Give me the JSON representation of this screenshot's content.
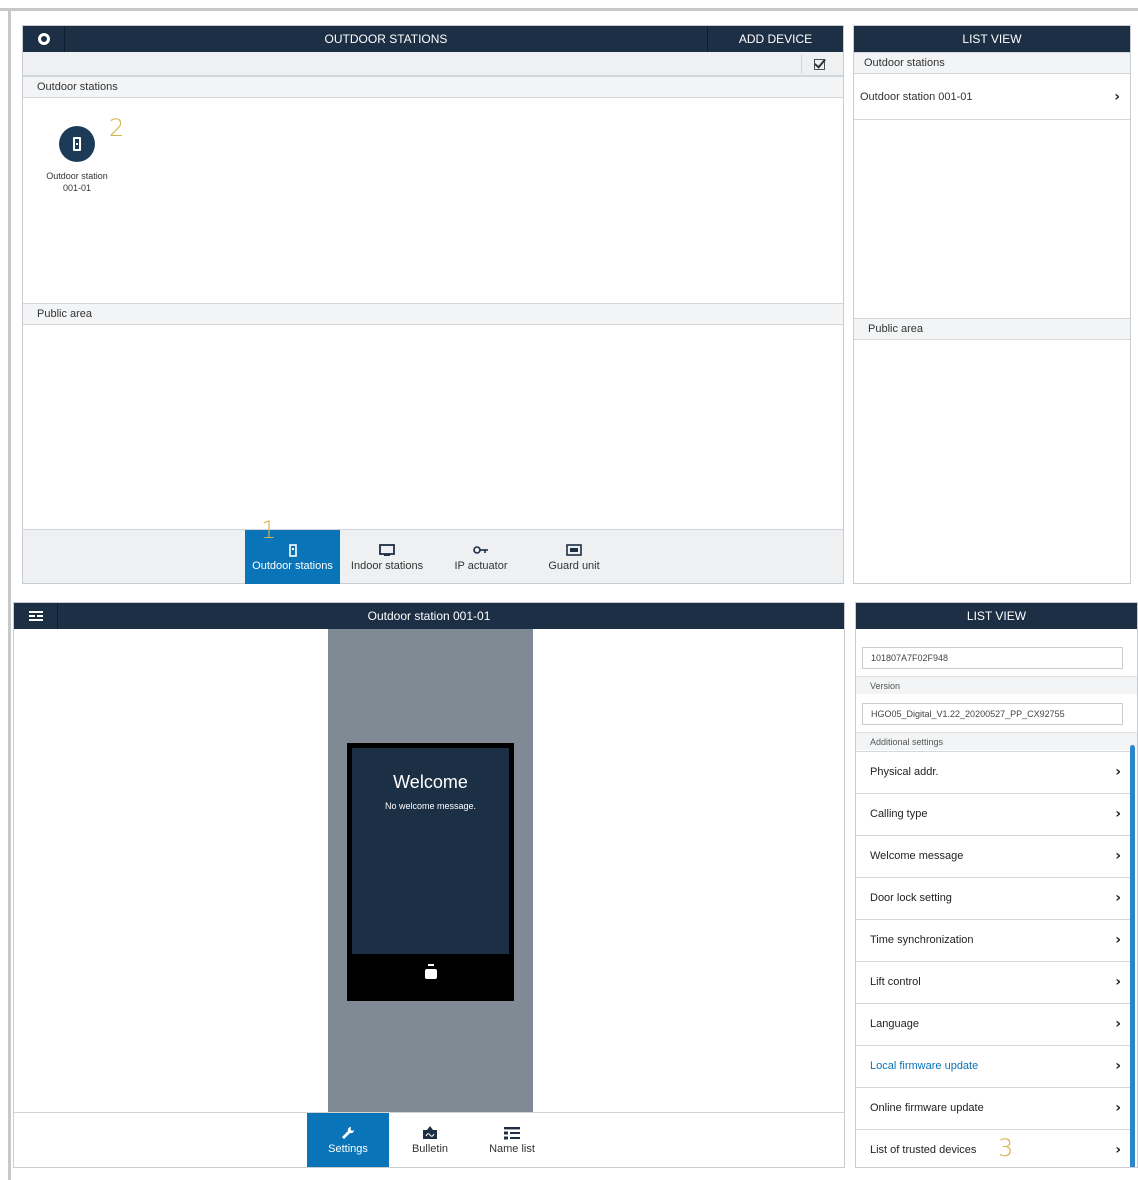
{
  "top_main": {
    "title": "OUTDOOR STATIONS",
    "add_device": "ADD DEVICE",
    "section_outdoor": "Outdoor stations",
    "device_label_line1": "Outdoor station",
    "device_label_line2": "001-01",
    "section_public": "Public area",
    "callout_2": "2",
    "callout_1": "1",
    "tabs": [
      {
        "label": "Outdoor stations",
        "icon": "outdoor-station-icon",
        "active": true
      },
      {
        "label": "Indoor stations",
        "icon": "indoor-station-icon",
        "active": false
      },
      {
        "label": "IP actuator",
        "icon": "key-icon",
        "active": false
      },
      {
        "label": "Guard unit",
        "icon": "guard-unit-icon",
        "active": false
      }
    ]
  },
  "top_right": {
    "title": "LIST VIEW",
    "section_outdoor": "Outdoor stations",
    "item": "Outdoor station 001-01",
    "section_public": "Public area"
  },
  "bottom_main": {
    "title": "Outdoor station 001-01",
    "welcome_title": "Welcome",
    "welcome_message": "No welcome message.",
    "tabs": [
      {
        "label": "Settings",
        "icon": "wrench-icon",
        "active": true
      },
      {
        "label": "Bulletin",
        "icon": "bulletin-icon",
        "active": false
      },
      {
        "label": "Name list",
        "icon": "name-list-icon",
        "active": false
      }
    ]
  },
  "bottom_right": {
    "title": "LIST VIEW",
    "serial_value": "101807A7F02F948",
    "version_label": "Version",
    "version_value": "HGO05_Digital_V1.22_20200527_PP_CX92755",
    "additional_label": "Additional settings",
    "settings": [
      "Physical addr.",
      "Calling type",
      "Welcome message",
      "Door lock setting",
      "Time synchronization",
      "Lift control",
      "Language",
      "Local firmware update",
      "Online firmware update",
      "List of trusted devices"
    ],
    "callout_3": "3"
  },
  "colors": {
    "header_bar": "#1d2f45",
    "active_tab": "#0a74b8",
    "callout": "#d4b34a",
    "link": "#0a74b8"
  }
}
